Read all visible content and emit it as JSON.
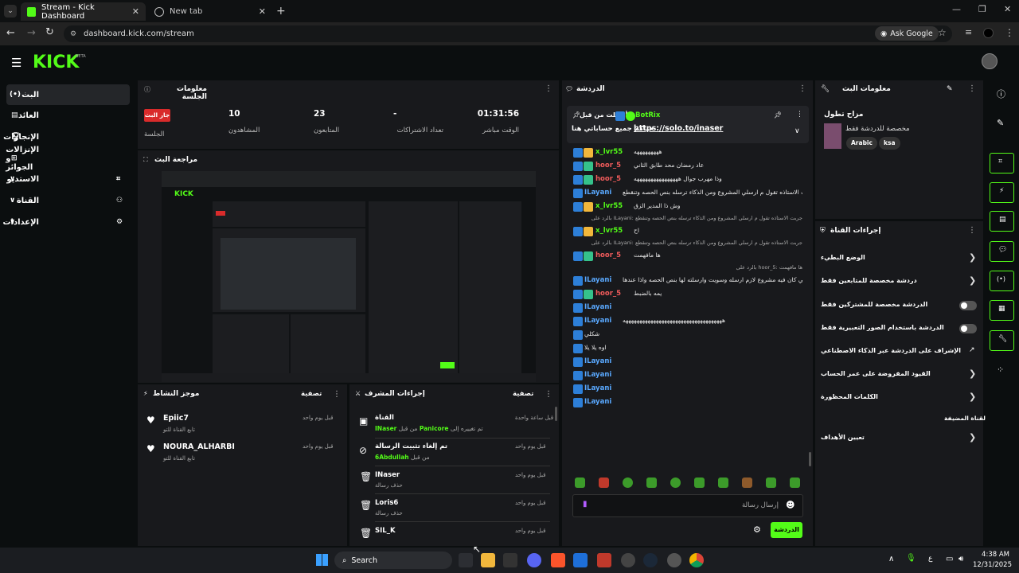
{
  "browser": {
    "tabs": [
      {
        "label": "Stream - Kick Dashboard",
        "active": true
      },
      {
        "label": "New tab",
        "active": false
      }
    ],
    "url": "dashboard.kick.com/stream",
    "ask_google": "Ask Google"
  },
  "kick": {
    "logo": "KICK",
    "beta": "BETA"
  },
  "nav": [
    "البث",
    "العائد",
    "الإنجازات",
    "الإنزالات و الجوائز",
    "الاستديو",
    "القناة",
    "الإعدادات"
  ],
  "session": {
    "title": "معلومات الجلسة",
    "stats": [
      {
        "value": "01:31:56",
        "label": "الوقت مباشر"
      },
      {
        "value": "-",
        "label": "تعداد الاشتراكات"
      },
      {
        "value": "23",
        "label": "المتابعون"
      },
      {
        "value": "10",
        "label": "المشاهدون"
      },
      {
        "badge": "جار البث",
        "label": "الجلسة"
      }
    ]
  },
  "preview": {
    "title": "مراجعة البث"
  },
  "activity": {
    "title": "موجز النشاط",
    "filter": "تصفية",
    "items": [
      {
        "name": "Epiic7",
        "sub": "تابع القناة للتو",
        "time": "قبل يوم واحد"
      },
      {
        "name": "NOURA_ALHARBI",
        "sub": "تابع القناة للتو",
        "time": "قبل يوم واحد"
      }
    ]
  },
  "mod": {
    "title": "إجراءات المشرف",
    "filter": "تصفية",
    "items": [
      {
        "title": "القناة",
        "sub_user": "INaser",
        "sub_mid": "من قبل",
        "sub_user2": "Panicore",
        "sub_end": "تم تغييره إلى",
        "time": "قبل ساعة واحدة"
      },
      {
        "title": "تم إلغاء تثبيت الرسالة",
        "sub_user": "6Abdullah",
        "sub_mid": "من قبل",
        "time": "قبل يوم واحد"
      },
      {
        "title": "INaser",
        "sub": "حذف رسالة",
        "time": "قبل يوم واحد"
      },
      {
        "title": "Loris6",
        "sub": "حذف رسالة",
        "time": "قبل يوم واحد"
      },
      {
        "title": "SIL_K",
        "sub": "",
        "time": "قبل يوم واحد"
      }
    ]
  },
  "chat": {
    "title": "الدردشة",
    "pinned_by": "أرسلت من قبل",
    "pinned_user": "BotRix",
    "pinned_text": "حياكم جميع حساباتي هنا",
    "pinned_link": "https://solo.to/inaser",
    "messages": [
      {
        "user": "x_lvr55",
        "color": "green",
        "text": "هههههههههه"
      },
      {
        "user": "hoor_5",
        "color": "red",
        "text": "عاد رمضان محد طابق الثاني"
      },
      {
        "user": "hoor_5",
        "color": "red",
        "text": "وذا مهرب جوال ههههههههههههههههه"
      },
      {
        "user": "ILayani",
        "color": "blue",
        "text": "جربت الاستاذه تقول م ارسلي المشروع ومن الذكاء ترسله بنص الحصه وتنقطع"
      },
      {
        "user": "x_lvr55",
        "color": "green",
        "text": "وش ذا المدير الزق"
      },
      {
        "user": "x_lvr55",
        "color": "green",
        "text": "اح",
        "reply": "بالرد على ILayani: جربت الاستاذه تقول م ارسلي المشروع ومن الذكاء ترسله بنص الحصه وتنقطع"
      },
      {
        "user": "hoor_5",
        "color": "red",
        "text": "ها مافهمت",
        "reply": "بالرد على ILayani: جربت الاستاذه تقول م ارسلي المشروع ومن الذكاء ترسله بنص الحصه وتنقطع"
      },
      {
        "user": "ILayani",
        "color": "blue",
        "text": "يعني كان فيه مشروع لازم ارسله وسويت وارسلته لها بنص الحصه واذا عندها",
        "reply": "بالرد على hoor_5: ها مافهمت"
      },
      {
        "user": "hoor_5",
        "color": "red",
        "text": "يمه بالضبط"
      },
      {
        "user": "ILayani",
        "color": "blue",
        "text": ""
      },
      {
        "user": "ILayani",
        "color": "blue",
        "text": "ههههههههههههههههههههههههههههههههههههه"
      },
      {
        "user": "",
        "color": "blue",
        "text": "شكلي"
      },
      {
        "user": "",
        "color": "blue",
        "text": "اوه يلا يلا"
      },
      {
        "user": "ILayani",
        "color": "blue",
        "text": ""
      },
      {
        "user": "ILayani",
        "color": "blue",
        "text": ""
      },
      {
        "user": "ILayani",
        "color": "blue",
        "text": ""
      },
      {
        "user": "ILayani",
        "color": "blue",
        "text": ""
      }
    ],
    "placeholder": "إرسال رسالة",
    "send": "الدردشة"
  },
  "stream_info": {
    "title": "معلومات البث",
    "stream_title": "مزاح تطول",
    "category": "مخصصة للدردشة فقط",
    "tags": [
      "Arabic",
      "ksa"
    ]
  },
  "channel_actions": {
    "title": "إجراءات القناة",
    "items": [
      {
        "label": "الوضع البطيء",
        "control": "chevron"
      },
      {
        "label": "دردشة مخصصة للمتابعين فقط",
        "control": "chevron"
      },
      {
        "label": "الدردشة مخصصة للمشتركين فقط",
        "control": "toggle"
      },
      {
        "label": "الدردشة باستخدام الصور التعبيرية فقط",
        "control": "toggle"
      },
      {
        "label": "الإشراف على الدردشة عبر الذكاء الاصطناعي",
        "control": "external"
      },
      {
        "label": "القيود المفروضة على عمر الحساب",
        "control": "chevron"
      },
      {
        "label": "الكلمات المحظورة",
        "control": "chevron"
      },
      {
        "label": "القناة المضيفة",
        "control": "header"
      },
      {
        "label": "تعيين الأهداف",
        "control": "chevron"
      }
    ]
  },
  "taskbar": {
    "search": "Search",
    "time": "4:38 AM",
    "date": "12/31/2025",
    "lang": "ع"
  }
}
